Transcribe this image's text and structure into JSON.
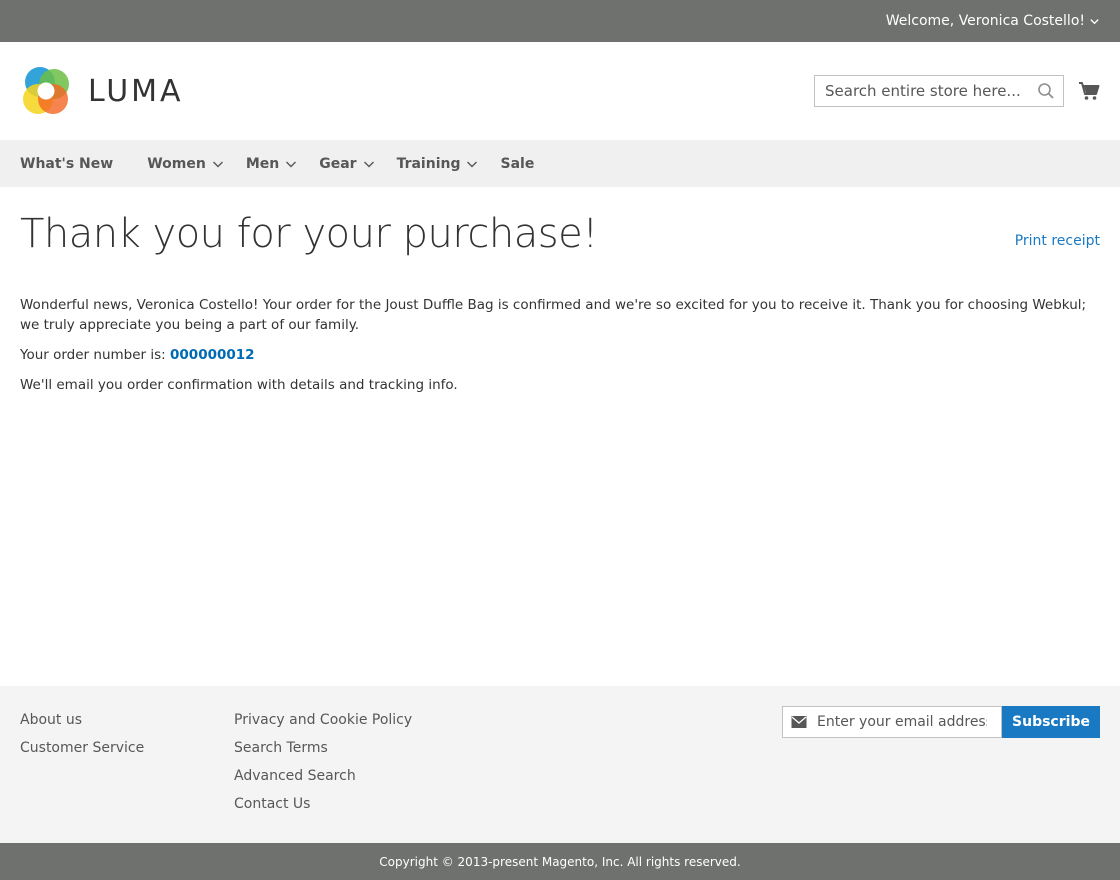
{
  "topbar": {
    "welcome": "Welcome, Veronica Costello!"
  },
  "header": {
    "logo_text": "LUMA",
    "search_placeholder": "Search entire store here..."
  },
  "nav": {
    "items": [
      {
        "label": "What's New"
      },
      {
        "label": "Women"
      },
      {
        "label": "Men"
      },
      {
        "label": "Gear"
      },
      {
        "label": "Training"
      },
      {
        "label": "Sale"
      }
    ]
  },
  "main": {
    "title": "Thank you for your purchase!",
    "print_receipt": "Print receipt",
    "message": "Wonderful news, Veronica Costello! Your order for the Joust Duffle Bag is confirmed and we're so excited for you to receive it. Thank you for choosing Webkul; we truly appreciate you being a part of our family.",
    "order_prefix": "Your order number is: ",
    "order_number": "000000012",
    "email_note": "We'll email you order confirmation with details and tracking info."
  },
  "footer": {
    "col1": [
      "About us",
      "Customer Service"
    ],
    "col2": [
      "Privacy and Cookie Policy",
      "Search Terms",
      "Advanced Search",
      "Contact Us"
    ],
    "email_placeholder": "Enter your email address",
    "subscribe_label": "Subscribe"
  },
  "copyright": "Copyright © 2013-present Magento, Inc. All rights reserved.",
  "colors": {
    "topbar": "#6e716e",
    "accent": "#1979c3",
    "nav_bg": "#f0f0f0",
    "footer_bg": "#f4f4f4"
  }
}
